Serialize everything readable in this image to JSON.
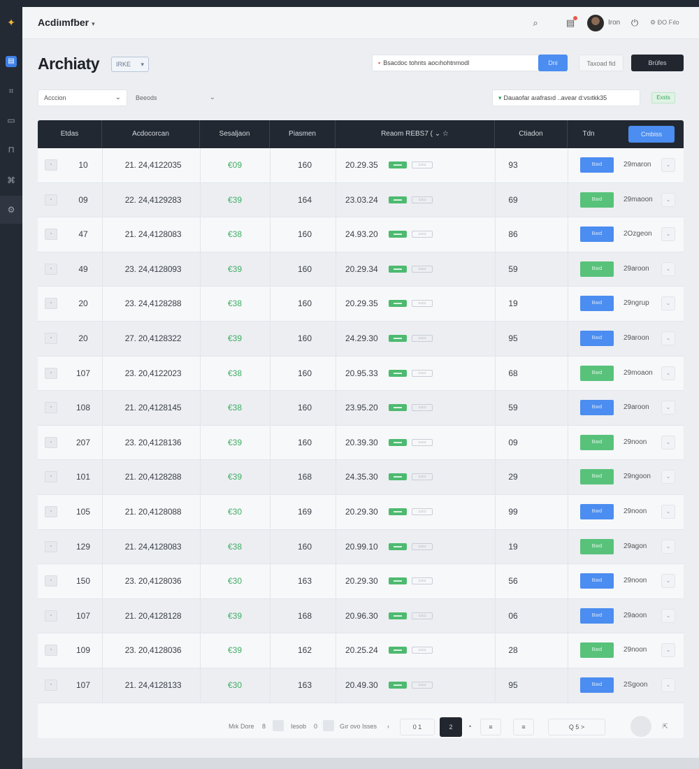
{
  "topbar": {
    "brand": "Acdiımfber",
    "user_name": "Iron",
    "extra": "⚙ ĐO Fılo"
  },
  "page": {
    "title": "Archiaty",
    "badge": "IRKE"
  },
  "toolbar": {
    "search_value": "Bsacdoc tohnts aocıhohtnmodl",
    "go_label": "Dni",
    "secondary_label": "Taxoad fid",
    "primary_label": "Brüfes"
  },
  "filters": {
    "select1": "Acccion",
    "select2": "Beeods",
    "filter_value": "Dauaofar aıafrasıd ..avear d:vsıtkk35",
    "export_label": "Exsts"
  },
  "table": {
    "headers": [
      "Etdas",
      "Acdocorcan",
      "Sesaljaon",
      "Piasmen",
      "Reaom REBS7 ( ⌄ ☆",
      "Ctiadon",
      "Tdn"
    ],
    "header_button": "Cmbiss",
    "rows": [
      {
        "chk": "▫",
        "id": "10",
        "time": "21.  24,4122035",
        "status": "€09",
        "qty": "160",
        "date": "20.29.35",
        "tag1": "▬▬",
        "tag2": "▭▭",
        "dur": "93",
        "action": "Baıd",
        "action_color": "blue",
        "more": "29maron"
      },
      {
        "chk": "▫",
        "id": "09",
        "time": "22.  24,4129283",
        "status": "€39",
        "qty": "164",
        "date": "23.03.24",
        "tag1": "▬▬",
        "tag2": "▭▭",
        "dur": "69",
        "action": "Baıd",
        "action_color": "green",
        "more": "29maoon"
      },
      {
        "chk": "▫",
        "id": "47",
        "time": "21.  24,4128083",
        "status": "€38",
        "qty": "160",
        "date": "24.93.20",
        "tag1": "▬▬",
        "tag2": "▭▭",
        "dur": "86",
        "action": "Baıd",
        "action_color": "blue",
        "more": "2Ozgeon"
      },
      {
        "chk": "▫",
        "id": "49",
        "time": "23.  24,4128093",
        "status": "€39",
        "qty": "160",
        "date": "20.29.34",
        "tag1": "▬▬",
        "tag2": "▭▭",
        "dur": "59",
        "action": "Baıd",
        "action_color": "green",
        "more": "29aroon"
      },
      {
        "chk": "▫",
        "id": "20",
        "time": "23.  24,4128288",
        "status": "€38",
        "qty": "160",
        "date": "20.29.35",
        "tag1": "▬▬",
        "tag2": "▭▭",
        "dur": "19",
        "action": "Baıd",
        "action_color": "blue",
        "more": "29ngrup"
      },
      {
        "chk": "▫",
        "id": "20",
        "time": "27.  20,4128322",
        "status": "€39",
        "qty": "160",
        "date": "24.29.30",
        "tag1": "▬▬",
        "tag2": "▭▭",
        "dur": "95",
        "action": "Baıd",
        "action_color": "blue",
        "more": "29aroon"
      },
      {
        "chk": "▫",
        "id": "107",
        "time": "23.  20,4122023",
        "status": "€38",
        "qty": "160",
        "date": "20.95.33",
        "tag1": "▬▬",
        "tag2": "▭▭",
        "dur": "68",
        "action": "Baıd",
        "action_color": "green",
        "more": "29moaon"
      },
      {
        "chk": "▫",
        "id": "108",
        "time": "21.  20,4128145",
        "status": "€38",
        "qty": "160",
        "date": "23.95.20",
        "tag1": "▬▬",
        "tag2": "▭▭",
        "dur": "59",
        "action": "Baıd",
        "action_color": "blue",
        "more": "29aroon"
      },
      {
        "chk": "▫",
        "id": "207",
        "time": "23.  20,4128136",
        "status": "€39",
        "qty": "160",
        "date": "20.39.30",
        "tag1": "▬▬",
        "tag2": "▭▭",
        "dur": "09",
        "action": "Baıd",
        "action_color": "green",
        "more": "29noon"
      },
      {
        "chk": "▫",
        "id": "101",
        "time": "21.  20,4128288",
        "status": "€39",
        "qty": "168",
        "date": "24.35.30",
        "tag1": "▬▬",
        "tag2": "▭▭",
        "dur": "29",
        "action": "Baıd",
        "action_color": "green",
        "more": "29ngoon"
      },
      {
        "chk": "▫",
        "id": "105",
        "time": "21.  20,4128088",
        "status": "€30",
        "qty": "169",
        "date": "20.29.30",
        "tag1": "▬▬",
        "tag2": "▭▭",
        "dur": "99",
        "action": "Baıd",
        "action_color": "blue",
        "more": "29noon"
      },
      {
        "chk": "▫",
        "id": "129",
        "time": "21.  24,4128083",
        "status": "€38",
        "qty": "160",
        "date": "20.99.10",
        "tag1": "▬▬",
        "tag2": "▭▭",
        "dur": "19",
        "action": "Baıd",
        "action_color": "green",
        "more": "29agon"
      },
      {
        "chk": "▫",
        "id": "150",
        "time": "23.  20,4128036",
        "status": "€30",
        "qty": "163",
        "date": "20.29.30",
        "tag1": "▬▬",
        "tag2": "▭▭",
        "dur": "56",
        "action": "Baıd",
        "action_color": "blue",
        "more": "29noon"
      },
      {
        "chk": "▫",
        "id": "107",
        "time": "21.  20,4128128",
        "status": "€39",
        "qty": "168",
        "date": "20.96.30",
        "tag1": "▬▬",
        "tag2": "▭▭",
        "dur": "06",
        "action": "Baıd",
        "action_color": "blue",
        "more": "29aoon"
      },
      {
        "chk": "▫",
        "id": "109",
        "time": "23.  20,4128036",
        "status": "€39",
        "qty": "162",
        "date": "20.25.24",
        "tag1": "▬▬",
        "tag2": "▭▭",
        "dur": "28",
        "action": "Baıd",
        "action_color": "green",
        "more": "29noon"
      },
      {
        "chk": "▫",
        "id": "107",
        "time": "21.  24,4128133",
        "status": "€30",
        "qty": "163",
        "date": "20.49.30",
        "tag1": "▬▬",
        "tag2": "▭▭",
        "dur": "95",
        "action": "Baıd",
        "action_color": "blue",
        "more": "2Sgoon"
      }
    ]
  },
  "pager": {
    "rows_label": "Mık Dore",
    "rows_value": "8",
    "mid_label": "Iesob",
    "mid_value": "0",
    "range_label": "Gır ovo Isses",
    "page_first": "0  1",
    "page_active": "2",
    "page_dot": "•",
    "page_next": "≡",
    "page_last": "≡",
    "jump": "Q  5  >"
  },
  "colors": {
    "accent": "#4b8df0",
    "success": "#58c27a",
    "dark": "#22272f"
  }
}
